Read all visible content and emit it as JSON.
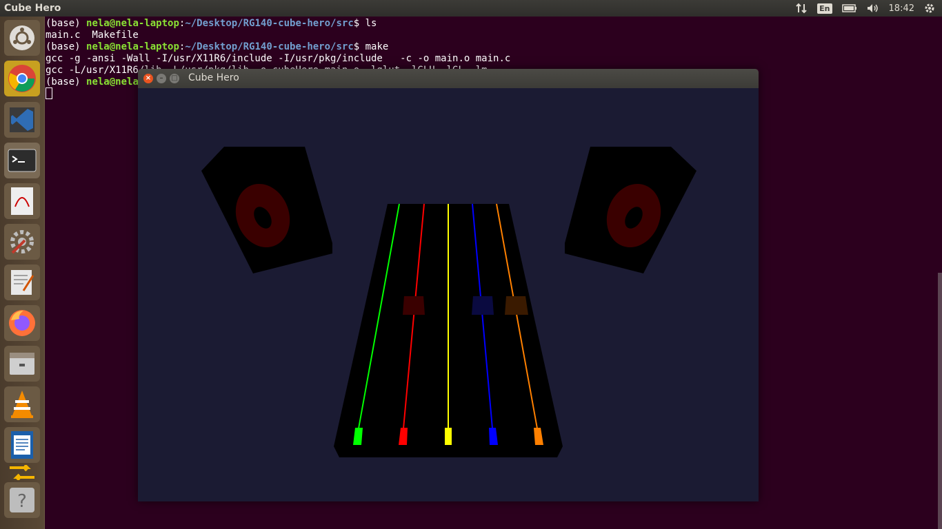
{
  "top_panel": {
    "title": "Cube Hero",
    "language": "En",
    "clock": "18:42",
    "icons": [
      "network-arrows-icon",
      "battery-icon",
      "volume-icon",
      "gear-icon"
    ]
  },
  "launcher": {
    "items": [
      {
        "name": "ubuntu-dash-icon",
        "color": "#e0ddd8"
      },
      {
        "name": "chrome-icon",
        "color": "#4285f4"
      },
      {
        "name": "vscode-icon",
        "color": "#2f6db5"
      },
      {
        "name": "terminal-icon",
        "color": "#2c2c2c"
      },
      {
        "name": "pdf-viewer-icon",
        "color": "#d8d8d8"
      },
      {
        "name": "system-settings-icon",
        "color": "#bdbdbd"
      },
      {
        "name": "text-editor-icon",
        "color": "#dcdcdc"
      },
      {
        "name": "firefox-icon",
        "color": "#ff7139"
      },
      {
        "name": "file-manager-icon",
        "color": "#cfcfcf"
      },
      {
        "name": "vlc-icon",
        "color": "#f48b00"
      },
      {
        "name": "writer-icon",
        "color": "#1b5faa"
      },
      {
        "name": "help-icon",
        "color": "#bdbdbd"
      }
    ]
  },
  "terminal": {
    "lines": [
      {
        "prompt_env": "(base) ",
        "user": "nela@nela-laptop",
        "sep": ":",
        "path": "~/Desktop/RG140-cube-hero/src",
        "cmd": "$ ls"
      },
      {
        "text": "main.c  Makefile"
      },
      {
        "prompt_env": "(base) ",
        "user": "nela@nela-laptop",
        "sep": ":",
        "path": "~/Desktop/RG140-cube-hero/src",
        "cmd": "$ make"
      },
      {
        "text": "gcc -g -ansi -Wall -I/usr/X11R6/include -I/usr/pkg/include   -c -o main.o main.c"
      },
      {
        "text": "gcc -L/usr/X11R6/lib -L/usr/pkg/lib -o cubeHero main.o -lglut -lGLU -lGL -lm"
      },
      {
        "prompt_env": "(base) ",
        "user": "nela@nela",
        "sep": "",
        "path": "",
        "cmd": ""
      }
    ]
  },
  "game_window": {
    "title": "Cube Hero",
    "buttons": {
      "close": "×",
      "minimize": "–",
      "maximize": "□"
    },
    "colors": {
      "background": "#1b1b33",
      "fretboard": "#000000",
      "speaker_cone": "#3a0000",
      "lanes": [
        "#00ff00",
        "#ff0000",
        "#ffff00",
        "#0000ff",
        "#ff8000"
      ],
      "falling_notes": [
        "#3a0000",
        "#0a0a40",
        "#3a1a00"
      ]
    }
  }
}
